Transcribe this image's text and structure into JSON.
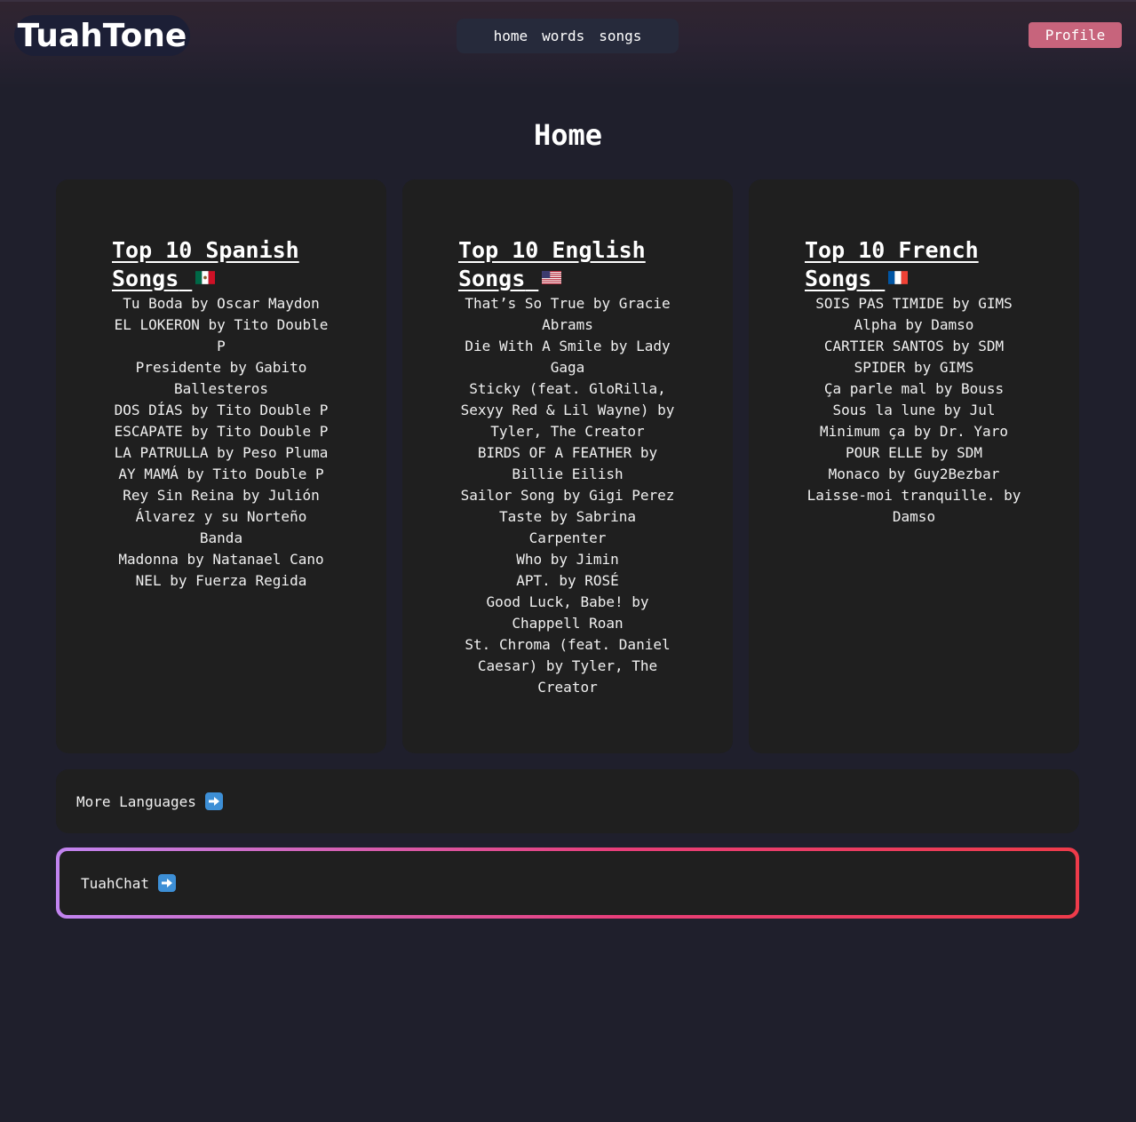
{
  "header": {
    "logo": "TuahTone",
    "nav": [
      "home",
      "words",
      "songs"
    ],
    "profile_label": "Profile"
  },
  "page_title": "Home",
  "cards": [
    {
      "title": "Top 10 Spanish Songs",
      "flag": "mexico-flag",
      "songs": [
        "Tu Boda by Oscar Maydon",
        "EL LOKERON by Tito Double P",
        "Presidente by Gabito Ballesteros",
        "DOS DÍAS by Tito Double P",
        "ESCAPATE by Tito Double P",
        "LA PATRULLA by Peso Pluma",
        "AY MAMÁ by Tito Double P",
        "Rey Sin Reina by Julión Álvarez y su Norteño Banda",
        "Madonna by Natanael Cano",
        "NEL by Fuerza Regida"
      ]
    },
    {
      "title": "Top 10 English Songs",
      "flag": "usa-flag",
      "songs": [
        "That’s So True by Gracie Abrams",
        "Die With A Smile by Lady Gaga",
        "Sticky (feat. GloRilla, Sexyy Red & Lil Wayne) by Tyler, The Creator",
        "BIRDS OF A FEATHER by Billie Eilish",
        "Sailor Song by Gigi Perez",
        "Taste by Sabrina Carpenter",
        "Who by Jimin",
        "APT. by ROSÉ",
        "Good Luck, Babe! by Chappell Roan",
        "St. Chroma (feat. Daniel Caesar) by Tyler, The Creator"
      ]
    },
    {
      "title": "Top 10 French Songs",
      "flag": "france-flag",
      "songs": [
        "SOIS PAS TIMIDE by GIMS",
        "Alpha by Damso",
        "CARTIER SANTOS by SDM",
        "SPIDER by GIMS",
        "Ça parle mal by Bouss",
        "Sous la lune by Jul",
        "Minimum ça by Dr. Yaro",
        "POUR ELLE by SDM",
        "Monaco by Guy2Bezbar",
        "Laisse-moi tranquille. by Damso"
      ]
    }
  ],
  "more_languages": "More Languages",
  "tuahchat": "TuahChat",
  "colors": {
    "background": "#1f1f2c",
    "card": "#1f1f1f",
    "profile": "#c7647c",
    "nav": "#262a3b"
  }
}
